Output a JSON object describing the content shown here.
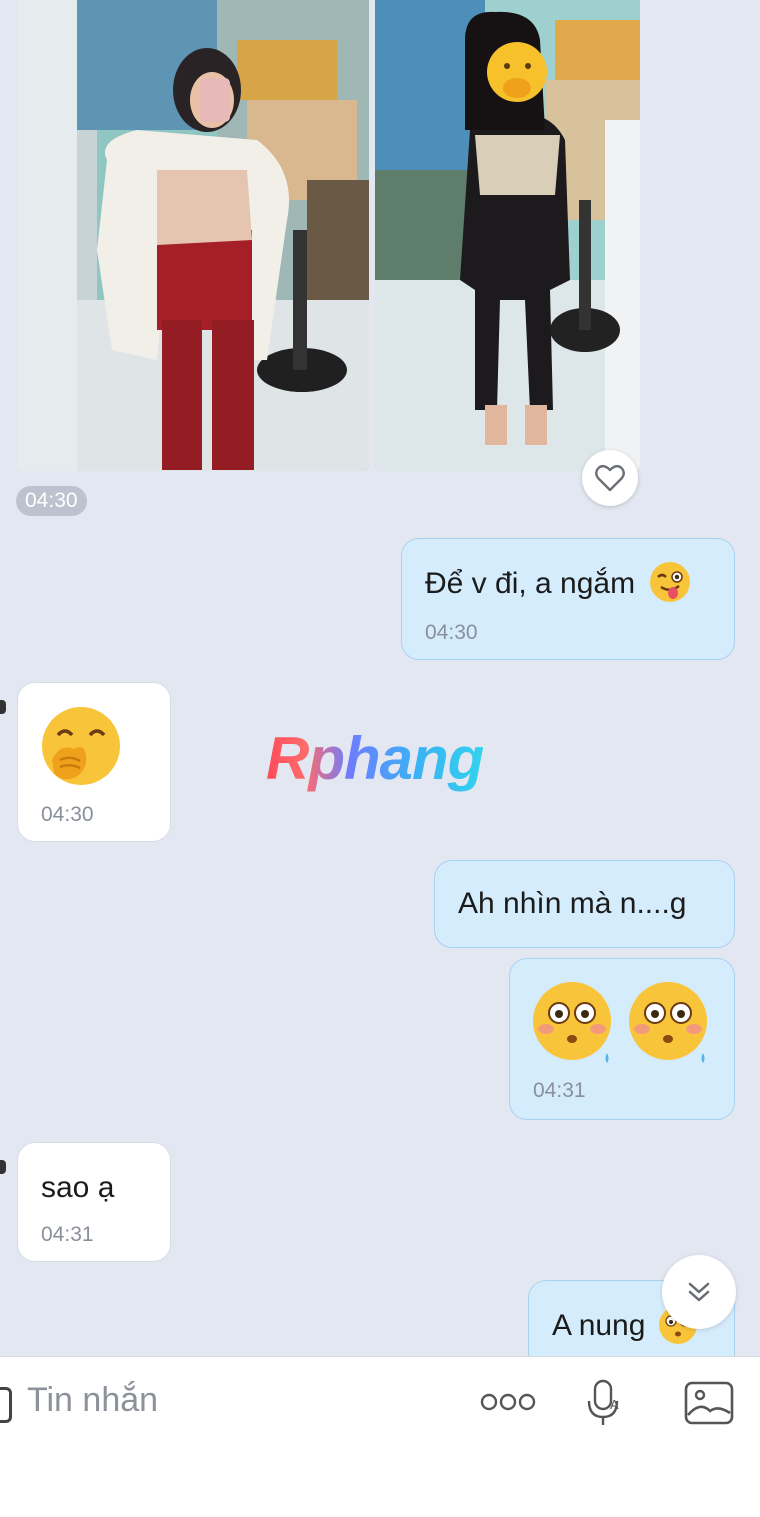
{
  "chat": {
    "photos_time": "04:30",
    "messages": [
      {
        "side": "out",
        "text": "Để v đi, a ngắm",
        "emoji": "winking-tongue-emoji",
        "time": "04:30"
      },
      {
        "side": "in",
        "emoji": "giggle-emoji",
        "time": "04:30"
      },
      {
        "side": "out",
        "text": "Ah nhìn mà n....g"
      },
      {
        "side": "out",
        "emoji": "flushed-emoji",
        "emoji_count": 2,
        "time": "04:31"
      },
      {
        "side": "in",
        "text": "sao ạ",
        "time": "04:31"
      },
      {
        "side": "out",
        "text": "A nung",
        "emoji": "flushed-emoji"
      }
    ]
  },
  "watermark": "Rphang",
  "input": {
    "placeholder": "Tin nhắn"
  },
  "icons": {
    "reaction": "heart-icon",
    "scroll": "chevron-double-down-icon",
    "more": "more-dots-icon",
    "voice": "microphone-icon",
    "gallery": "image-icon"
  },
  "colors": {
    "background": "#e2e7f1",
    "bubble_out": "#d5ecfd",
    "bubble_in": "#ffffff"
  }
}
